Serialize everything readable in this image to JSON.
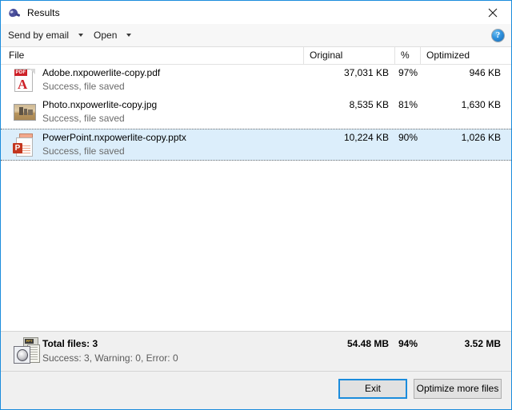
{
  "window": {
    "title": "Results",
    "icon": "app-logo-icon",
    "close_label": "✕",
    "accent_color": "#1b8cdc"
  },
  "toolbar": {
    "items": [
      {
        "label": "Send by email",
        "icon": "chevron-down-icon"
      },
      {
        "label": "Open",
        "icon": "chevron-down-icon"
      }
    ],
    "help": {
      "icon": "help-icon",
      "glyph": "?"
    }
  },
  "columns": {
    "file": "File",
    "original": "Original",
    "percent": "%",
    "optimized": "Optimized"
  },
  "files": [
    {
      "icon": "pdf-file-icon",
      "icon_label": "PDF",
      "name": "Adobe.nxpowerlite-copy.pdf",
      "status": "Success, file saved",
      "original": "37,031 KB",
      "percent": "97%",
      "optimized": "946 KB",
      "selected": false
    },
    {
      "icon": "image-file-icon",
      "icon_label": "",
      "name": "Photo.nxpowerlite-copy.jpg",
      "status": "Success, file saved",
      "original": "8,535 KB",
      "percent": "81%",
      "optimized": "1,630 KB",
      "selected": false
    },
    {
      "icon": "powerpoint-file-icon",
      "icon_label": "P",
      "name": "PowerPoint.nxpowerlite-copy.pptx",
      "status": "Success, file saved",
      "original": "10,224 KB",
      "percent": "90%",
      "optimized": "1,026 KB",
      "selected": true
    }
  ],
  "summary": {
    "icon": "documents-stack-icon",
    "icon_label": "PPT",
    "title": "Total files: 3",
    "detail": "Success: 3, Warning: 0, Error: 0",
    "original": "54.48 MB",
    "percent": "94%",
    "optimized": "3.52 MB"
  },
  "footer": {
    "exit_label": "Exit",
    "optimize_more_label": "Optimize more files"
  }
}
